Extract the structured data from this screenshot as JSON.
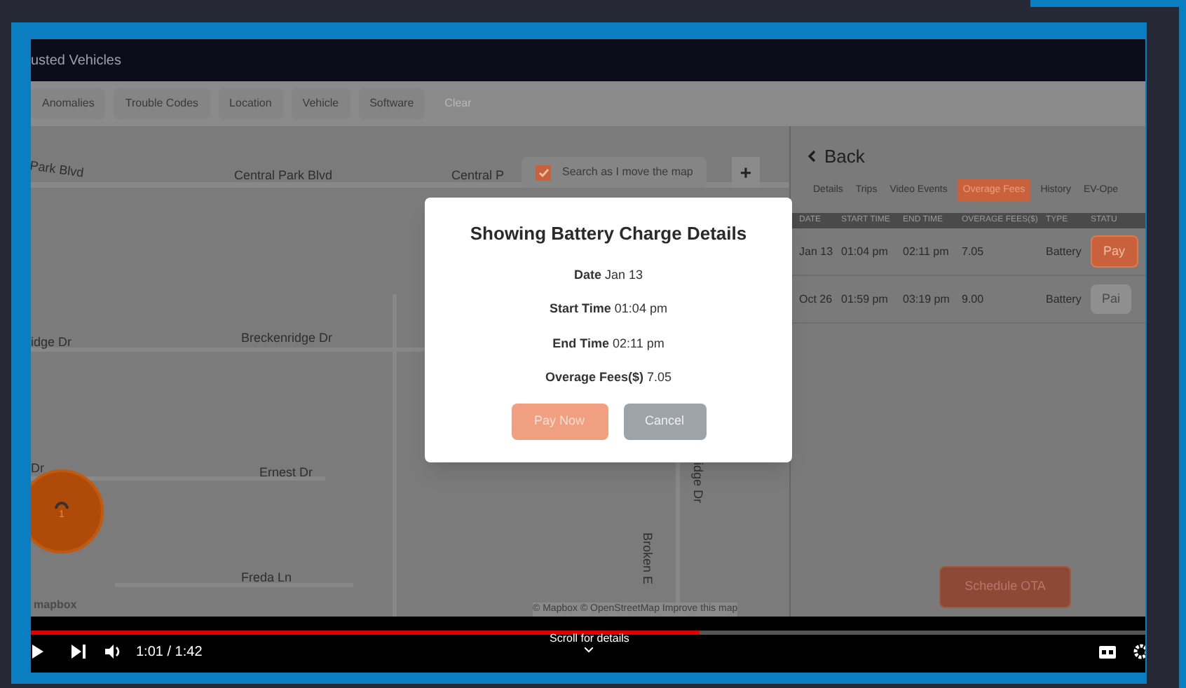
{
  "app": {
    "title": "usted Vehicles",
    "filters": [
      {
        "label": "Anomalies",
        "disabled": false
      },
      {
        "label": "Trouble Codes",
        "disabled": false
      },
      {
        "label": "Location",
        "disabled": false
      },
      {
        "label": "Vehicle",
        "disabled": false
      },
      {
        "label": "Software",
        "disabled": false
      },
      {
        "label": "Clear",
        "disabled": true
      }
    ]
  },
  "map": {
    "streets": [
      "Park Blvd",
      "Central Park Blvd",
      "Central P",
      "idge Dr",
      "Breckenridge Dr",
      "Dr",
      "Ernest Dr",
      "Freda Ln",
      "Broken E",
      "idge Dr"
    ],
    "search_toggle": {
      "label": "Search as I move the map",
      "checked": true
    },
    "zoom_in": "+",
    "cluster_count": "1",
    "logo": "mapbox",
    "attribution": "© Mapbox © OpenStreetMap Improve this map"
  },
  "panel": {
    "back": "Back",
    "tabs": [
      {
        "label": "Details",
        "selected": false
      },
      {
        "label": "Trips",
        "selected": false
      },
      {
        "label": "Video Events",
        "selected": false
      },
      {
        "label": "Overage Fees",
        "selected": true
      },
      {
        "label": "History",
        "selected": false
      },
      {
        "label": "EV-Ope",
        "selected": false
      }
    ],
    "columns": [
      "DATE",
      "START TIME",
      "END TIME",
      "OVERAGE FEES($)",
      "TYPE",
      "STATU"
    ],
    "rows": [
      {
        "date": "Jan 13",
        "start": "01:04 pm",
        "end": "02:11 pm",
        "fee": "7.05",
        "type": "Battery",
        "status": {
          "kind": "pay",
          "label": "Pay"
        }
      },
      {
        "date": "Oct 26",
        "start": "01:59 pm",
        "end": "03:19 pm",
        "fee": "9.00",
        "type": "Battery",
        "status": {
          "kind": "paid",
          "label": "Pai"
        }
      }
    ],
    "schedule": "Schedule OTA"
  },
  "modal": {
    "title": "Showing Battery Charge Details",
    "fields": [
      {
        "label": "Date",
        "value": "Jan 13"
      },
      {
        "label": "Start Time",
        "value": "01:04 pm"
      },
      {
        "label": "End Time",
        "value": "02:11 pm"
      },
      {
        "label": "Overage Fees($)",
        "value": "7.05"
      }
    ],
    "buttons": [
      {
        "kind": "primary",
        "label": "Pay Now"
      },
      {
        "kind": "secondary",
        "label": "Cancel"
      }
    ]
  },
  "player": {
    "progress": {
      "level": 0.6
    },
    "time": "1:01 / 1:42",
    "hint": "Scroll for details"
  }
}
